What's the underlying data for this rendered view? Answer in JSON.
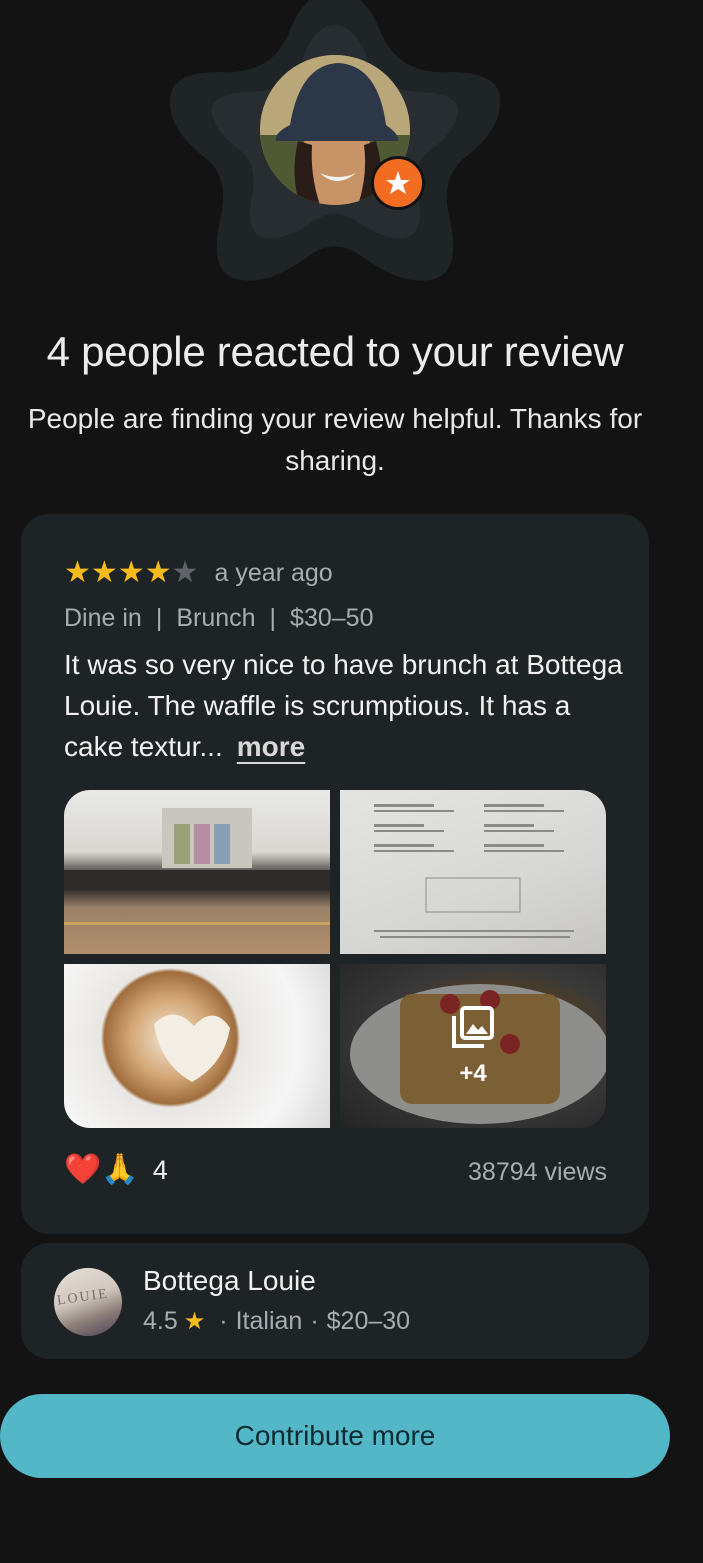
{
  "hero": {
    "title": "4 people reacted to your review",
    "subtitle": "People are finding your review helpful. Thanks for sharing."
  },
  "review": {
    "rating": 4,
    "max_rating": 5,
    "time_ago": "a year ago",
    "meta": [
      "Dine in",
      "Brunch",
      "$30–50"
    ],
    "text": "It was so very nice to have brunch at Bottega Louie. The waffle is scrumptious.  It has a cake textur...",
    "more_label": "more",
    "photos": {
      "extra_count": "+4"
    },
    "reactions": {
      "emojis": [
        "❤️",
        "🙏"
      ],
      "count": "4"
    },
    "views": "38794 views"
  },
  "place": {
    "name": "Bottega Louie",
    "rating": "4.5",
    "cuisine": "Italian",
    "price": "$20–30"
  },
  "actions": {
    "contribute_label": "Contribute more"
  },
  "colors": {
    "background": "#131314",
    "card": "#1e2326",
    "accent_button": "#53b7c8",
    "star": "#f9bb1a",
    "badge": "#f26d21"
  }
}
